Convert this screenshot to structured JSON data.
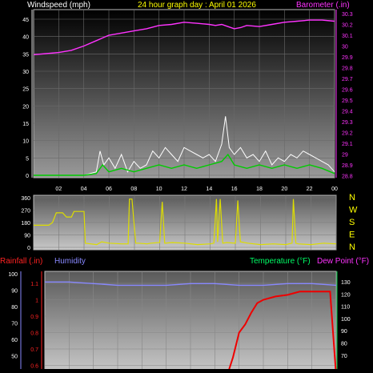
{
  "header": {
    "wind_label": "Windspeed (mph)",
    "title": "24 hour graph day : April 01 2026",
    "baro_label": "Barometer (.in)"
  },
  "wind_chart": {
    "type": "line",
    "x_ticks": [
      "02",
      "04",
      "06",
      "08",
      "10",
      "12",
      "14",
      "16",
      "18",
      "20",
      "22",
      "00"
    ],
    "y_left_ticks": [
      "45",
      "40",
      "35",
      "30",
      "25",
      "20",
      "15",
      "10",
      "5",
      "0"
    ],
    "y_right_ticks": [
      "30.3",
      "30.2",
      "30.1",
      "30",
      "29.9",
      "29.8",
      "29.7",
      "29.6",
      "29.5",
      "29.4",
      "29.3",
      "29.2",
      "29.1",
      "29",
      "28.9",
      "28.8"
    ],
    "ylim_left": [
      0,
      48
    ],
    "ylim_right": [
      28.75,
      30.33
    ],
    "grid": true,
    "series": [
      {
        "name": "Windspeed (mph)",
        "color": "#ffffff",
        "x": [
          0,
          2,
          4,
          5,
          5.3,
          5.6,
          6,
          6.5,
          7,
          7.5,
          8,
          8.5,
          9,
          9.5,
          10,
          10.5,
          11,
          11.5,
          12,
          12.5,
          13,
          13.5,
          14,
          14.5,
          15,
          15.3,
          15.6,
          16,
          16.5,
          17,
          17.5,
          18,
          18.5,
          19,
          19.5,
          20,
          20.5,
          21,
          21.5,
          22,
          22.5,
          23,
          23.5,
          24
        ],
        "y": [
          0,
          0,
          0,
          1,
          7,
          3,
          5,
          2,
          6,
          1,
          4,
          2,
          3,
          7,
          5,
          8,
          6,
          4,
          8,
          7,
          6,
          5,
          6,
          4,
          9,
          17,
          8,
          6,
          8,
          5,
          6,
          4,
          7,
          3,
          5,
          4,
          6,
          5,
          7,
          6,
          5,
          4,
          3,
          1
        ]
      },
      {
        "name": "Gust",
        "color": "#00cc00",
        "x": [
          0,
          2,
          4,
          5,
          5.5,
          6,
          7,
          8,
          9,
          10,
          11,
          12,
          13,
          14,
          15,
          15.5,
          16,
          17,
          18,
          19,
          20,
          21,
          22,
          23,
          24
        ],
        "y": [
          0,
          0,
          0,
          0.5,
          3,
          1,
          2,
          1,
          2,
          3,
          2,
          3,
          2,
          3,
          4,
          6,
          3,
          2,
          3,
          2,
          3,
          2,
          3,
          2,
          0.5
        ]
      },
      {
        "name": "Barometer (.in)",
        "color": "#ff33ff",
        "x": [
          0,
          1,
          2,
          3,
          4,
          5,
          6,
          7,
          8,
          9,
          10,
          11,
          12,
          13,
          14,
          14.5,
          15,
          15.5,
          16,
          16.5,
          17,
          18,
          19,
          20,
          21,
          22,
          23,
          24
        ],
        "y": [
          29.92,
          29.93,
          29.94,
          29.96,
          30.0,
          30.05,
          30.1,
          30.12,
          30.14,
          30.16,
          30.19,
          30.2,
          30.22,
          30.21,
          30.2,
          30.19,
          30.2,
          30.18,
          30.16,
          30.17,
          30.19,
          30.18,
          30.2,
          30.22,
          30.23,
          30.24,
          30.24,
          30.23
        ]
      }
    ]
  },
  "dir_chart": {
    "type": "line",
    "y_ticks": [
      "360",
      "270",
      "180",
      "90",
      "0"
    ],
    "ylim": [
      0,
      360
    ],
    "compass": [
      "N",
      "W",
      "S",
      "E",
      "N"
    ],
    "series": [
      {
        "name": "Wind direction",
        "color": "#dddd00",
        "x": [
          0,
          0.8,
          1.2,
          1.5,
          1.8,
          2.3,
          2.6,
          3.0,
          3.2,
          3.6,
          4.0,
          4.1,
          5.0,
          5.4,
          6.0,
          7.0,
          7.5,
          7.6,
          7.8,
          8.1,
          8.3,
          9.0,
          9.3,
          10.0,
          10.2,
          10.4,
          11.0,
          12.0,
          13.0,
          14.0,
          14.3,
          14.5,
          14.6,
          14.8,
          15.0,
          15.3,
          16.0,
          16.2,
          16.4,
          17.0,
          18.0,
          19.0,
          20.0,
          20.5,
          20.6,
          20.8,
          21.0,
          22.0,
          23.0,
          24.0
        ],
        "y": [
          160,
          160,
          160,
          180,
          250,
          250,
          220,
          220,
          260,
          260,
          260,
          30,
          20,
          40,
          30,
          25,
          25,
          350,
          350,
          30,
          30,
          25,
          30,
          35,
          330,
          30,
          35,
          30,
          20,
          25,
          30,
          350,
          40,
          350,
          30,
          35,
          30,
          340,
          40,
          30,
          20,
          25,
          20,
          30,
          350,
          30,
          25,
          20,
          30,
          25
        ]
      }
    ]
  },
  "temp_chart": {
    "type": "line",
    "rain_label": "Rainfall (.in)",
    "humidity_label": "Humidity",
    "temp_label": "Temperature (°F)",
    "dew_label": "Dew Point (°F)",
    "humidity_ticks": [
      "100",
      "90",
      "80",
      "70",
      "60",
      "50"
    ],
    "rain_ticks": [
      "1.1",
      "1",
      "0.9",
      "0.8",
      "0.7",
      "0.6"
    ],
    "temp_ticks": [
      "130",
      "120",
      "110",
      "100",
      "90",
      "80",
      "70"
    ],
    "series": [
      {
        "name": "Humidity",
        "color": "#8888ff",
        "x": [
          0,
          2,
          4,
          6,
          8,
          10,
          12,
          14,
          16,
          18,
          20,
          22,
          24
        ],
        "y": [
          95,
          95,
          94,
          93,
          93,
          93,
          94,
          94,
          93,
          93,
          94,
          94,
          93
        ]
      },
      {
        "name": "Rainfall (.in)",
        "color": "#ee0000",
        "x": [
          0,
          14,
          15,
          15.5,
          16,
          16.5,
          17,
          17.5,
          18,
          19,
          20,
          21,
          22,
          23,
          23.5,
          24
        ],
        "y": [
          0,
          0,
          0.5,
          0.65,
          0.8,
          0.85,
          0.92,
          0.98,
          1.0,
          1.02,
          1.03,
          1.05,
          1.05,
          1.05,
          1.05,
          0.0
        ]
      }
    ]
  }
}
